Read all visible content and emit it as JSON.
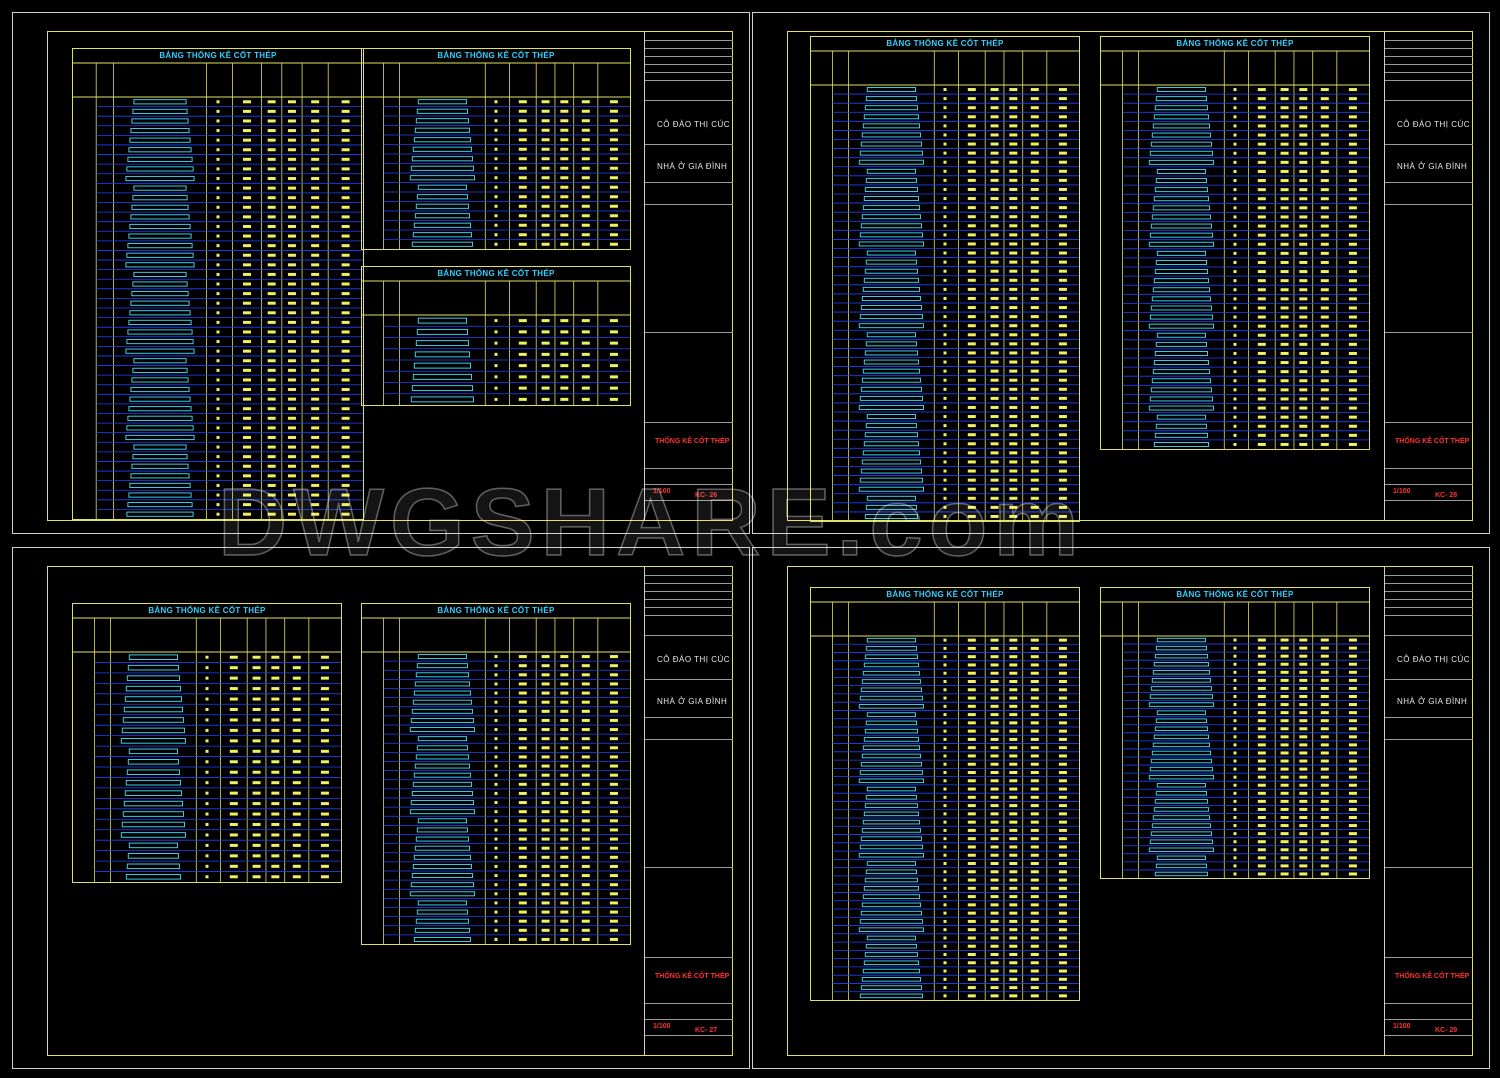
{
  "watermark": "DWGSHARE.com",
  "table_title": "BẢNG THỐNG KÊ CỐT THÉP",
  "owner": "CÔ ĐÀO THỊ CÚC",
  "project": "NHÀ Ở GIA ĐÌNH",
  "drawing_title": "THỐNG KÊ CỐT THÉP",
  "sheets": [
    {
      "scale": "1/100",
      "code": "KC- 26"
    },
    {
      "scale": "1/100",
      "code": "KC- 28"
    },
    {
      "scale": "1/100",
      "code": "KC- 27"
    },
    {
      "scale": "1/100",
      "code": "KC- 29"
    }
  ],
  "colors": {
    "frame": "#e0e060",
    "title": "#30d0ff",
    "rows": "#2040ff",
    "bars": "#40e0ff",
    "values": "#f0f060",
    "accent": "#ff3030"
  }
}
